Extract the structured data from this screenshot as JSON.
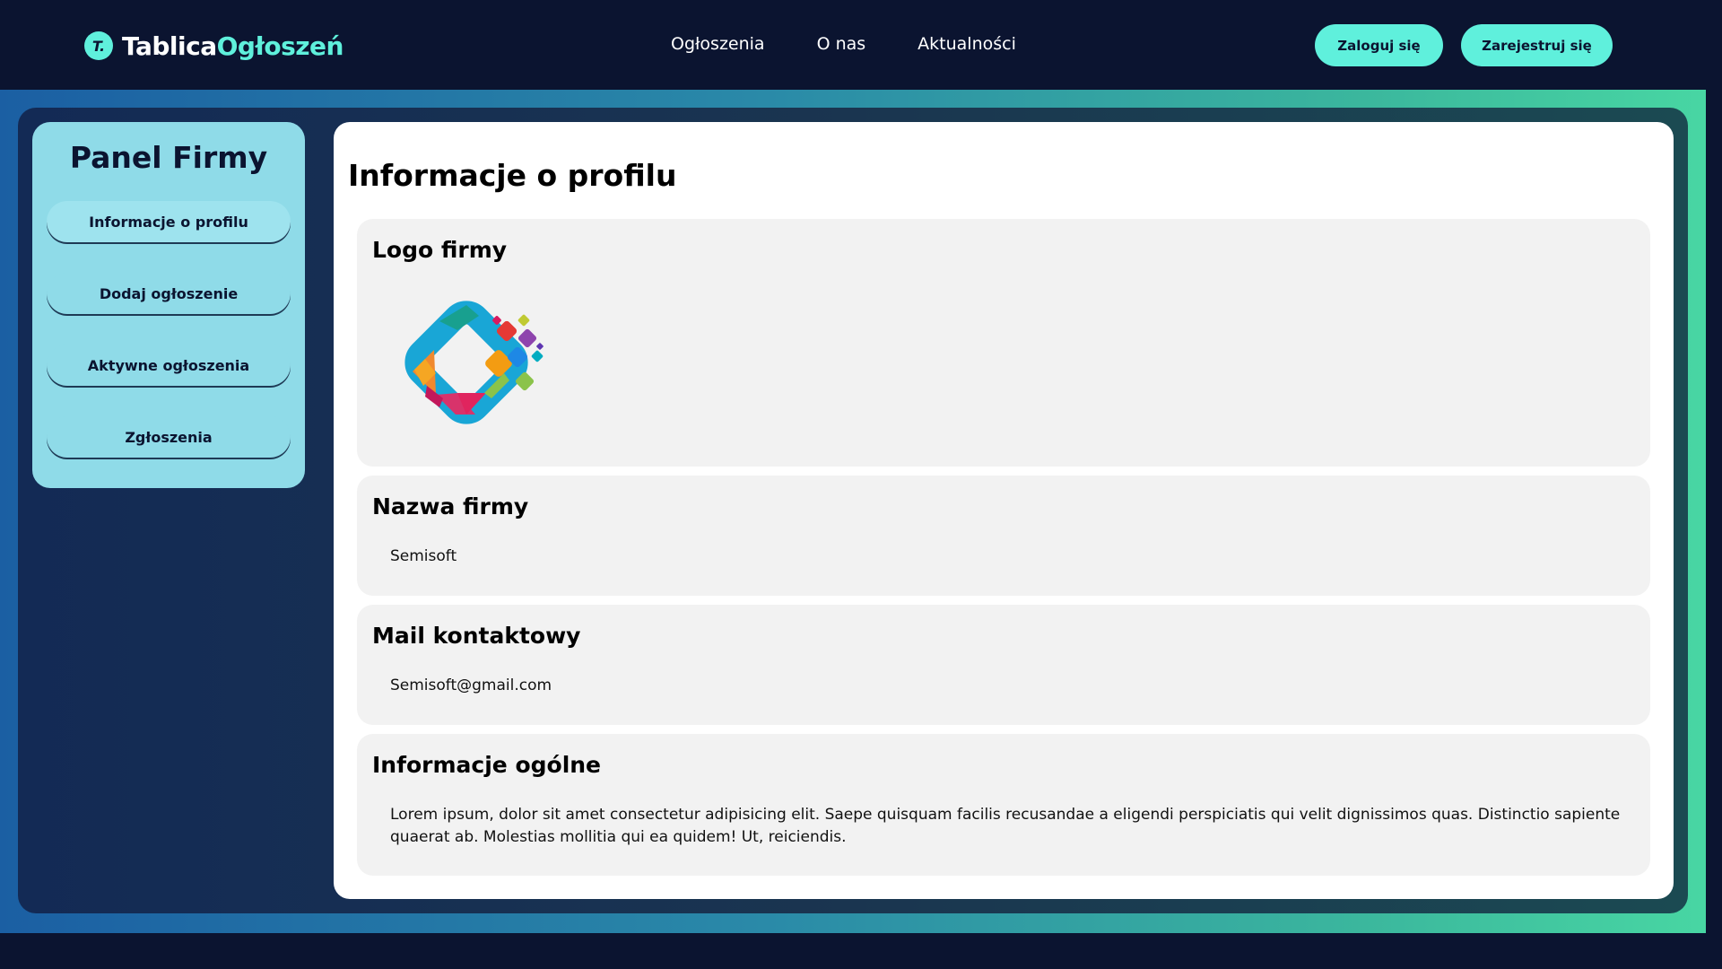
{
  "brand": {
    "badge": "T.",
    "word1": "Tablica",
    "word2": "Ogłoszeń"
  },
  "nav": {
    "items": [
      {
        "label": "Ogłoszenia"
      },
      {
        "label": "O nas"
      },
      {
        "label": "Aktualności"
      }
    ]
  },
  "auth": {
    "login_label": "Zaloguj się",
    "register_label": "Zarejestruj się"
  },
  "sidebar": {
    "title": "Panel Firmy",
    "items": [
      {
        "label": "Informacje o profilu",
        "active": true
      },
      {
        "label": "Dodaj ogłoszenie"
      },
      {
        "label": "Aktywne ogłoszenia"
      },
      {
        "label": "Zgłoszenia"
      }
    ]
  },
  "main": {
    "title": "Informacje o profilu",
    "logo_section": {
      "title": "Logo firmy",
      "icon": "company-logo-icon"
    },
    "name_section": {
      "title": "Nazwa firmy",
      "value": "Semisoft"
    },
    "mail_section": {
      "title": "Mail kontaktowy",
      "value": "Semisoft@gmail.com"
    },
    "general_section": {
      "title": "Informacje ogólne",
      "value": "Lorem ipsum, dolor sit amet consectetur adipisicing elit. Saepe quisquam facilis recusandae a eligendi perspiciatis qui velit dignissimos quas. Distinctio sapiente quaerat ab. Molestias mollitia qui ea quidem! Ut, reiciendis."
    }
  },
  "colors": {
    "accent": "#5ff0dc",
    "navbar": "#0b1430",
    "sidebar": "#8fdbe8",
    "card": "#f2f2f2"
  }
}
